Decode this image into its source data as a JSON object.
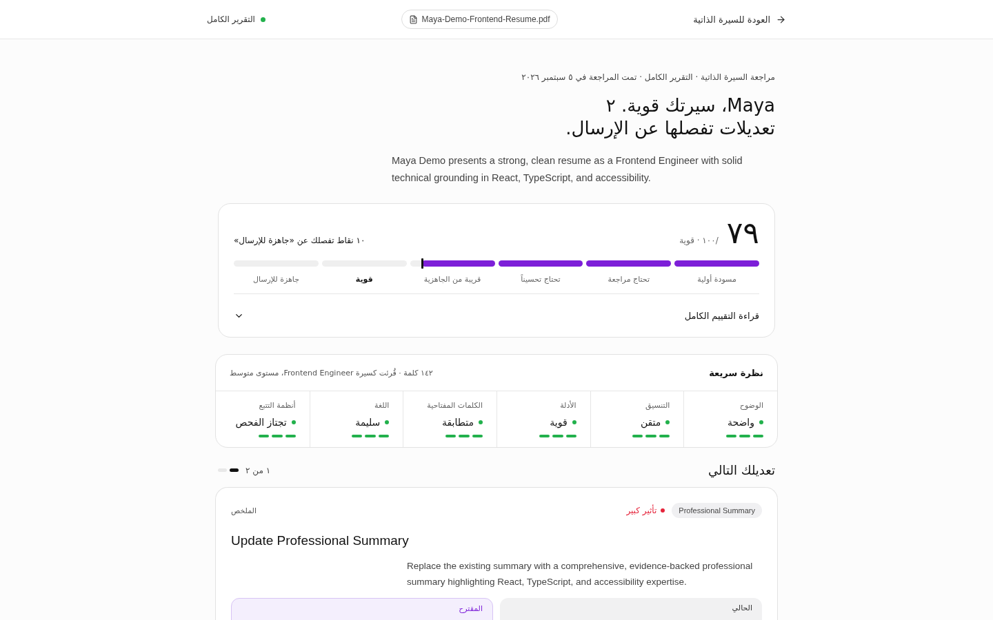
{
  "topbar": {
    "back_link": "العودة للسيرة الذاتية",
    "file_chip": "Maya-Demo-Frontend-Resume.pdf",
    "report_status": {
      "label": "التقرير الكامل",
      "color": "#22b14c"
    }
  },
  "breadcrumb": "مراجعة السيرة الذاتية · التقرير الكامل · تمت المراجعة في ٥ سبتمبر ٢٠٢٦",
  "headline": [
    "Maya، سيرتك قوية. ٢",
    "تعديلات تفصلها عن الإرسال."
  ],
  "intro": "Maya Demo presents a strong, clean resume as a Frontend Engineer with solid technical grounding in React, TypeScript, and accessibility.",
  "score_card": {
    "score": "٧٩",
    "out_of": "/١٠٠ · قوية",
    "gap_note": "١٠ نقاط تفصلك عن «جاهزة للإرسال»",
    "stages": [
      {
        "label": "مسودة أولية",
        "level": 1,
        "selected": false
      },
      {
        "label": "تحتاج مراجعة",
        "level": 1,
        "selected": false
      },
      {
        "label": "تحتاج تحسيناً",
        "level": 1,
        "selected": false
      },
      {
        "label": "قريبة من الجاهزية",
        "level": 0.86,
        "selected": false
      },
      {
        "label": "قوية",
        "selected": true
      },
      {
        "label": "جاهزة للإرسال",
        "selected": false
      }
    ],
    "full_review": {
      "label": "قراءة التقييم الكامل",
      "expanded": false
    }
  },
  "quick_view": {
    "title": "نظرة سريعة",
    "meta": "١٤٢ كلمة · قُرئت كسيرة Frontend Engineer، مستوى متوسط",
    "metrics": [
      {
        "label": "الوضوح",
        "value": "واضحة"
      },
      {
        "label": "التنسيق",
        "value": "متقن"
      },
      {
        "label": "الأدلة",
        "value": "قوية"
      },
      {
        "label": "الكلمات المفتاحية",
        "value": "متطابقة"
      },
      {
        "label": "اللغة",
        "value": "سليمة"
      },
      {
        "label": "أنظمة التتبع",
        "value": "تجتاز الفحص"
      }
    ]
  },
  "next_edit": {
    "title": "تعديلك التالي",
    "pager": "١ من ٢",
    "pages": [
      {
        "selected": true
      },
      {
        "selected": false
      }
    ],
    "card": {
      "section": "Professional Summary",
      "impact": {
        "label": "تأثير كبير",
        "color": "#e5243b"
      },
      "category": "الملخص",
      "title": "Update Professional Summary",
      "description": "Replace the existing summary with a comprehensive, evidence-backed professional summary highlighting React, TypeScript, and accessibility expertise.",
      "panels": [
        {
          "kind": "current",
          "label": "الحالي"
        },
        {
          "kind": "suggested",
          "label": "المقترح"
        }
      ]
    }
  }
}
